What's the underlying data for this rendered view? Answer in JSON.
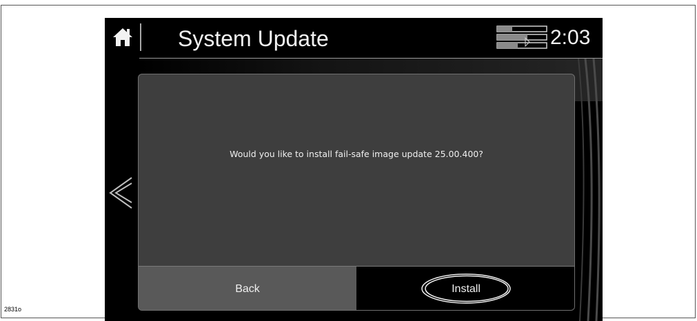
{
  "figure": {
    "number": "2831o"
  },
  "header": {
    "title": "System Update",
    "clock": "2:03"
  },
  "dialog": {
    "message": "Would you like to install fail-safe image update 25.00.400?",
    "back_label": "Back",
    "install_label": "Install"
  },
  "icons": {
    "home": "home-icon",
    "status": "signal-status-icon",
    "nav_back": "chevron-left-icon",
    "callout": "highlight-ellipse"
  },
  "colors": {
    "screen_bg": "#000000",
    "dialog_bg": "#3e3e3e",
    "back_button_bg": "#595959",
    "install_button_bg": "#000000",
    "text": "#f0f0f0"
  }
}
